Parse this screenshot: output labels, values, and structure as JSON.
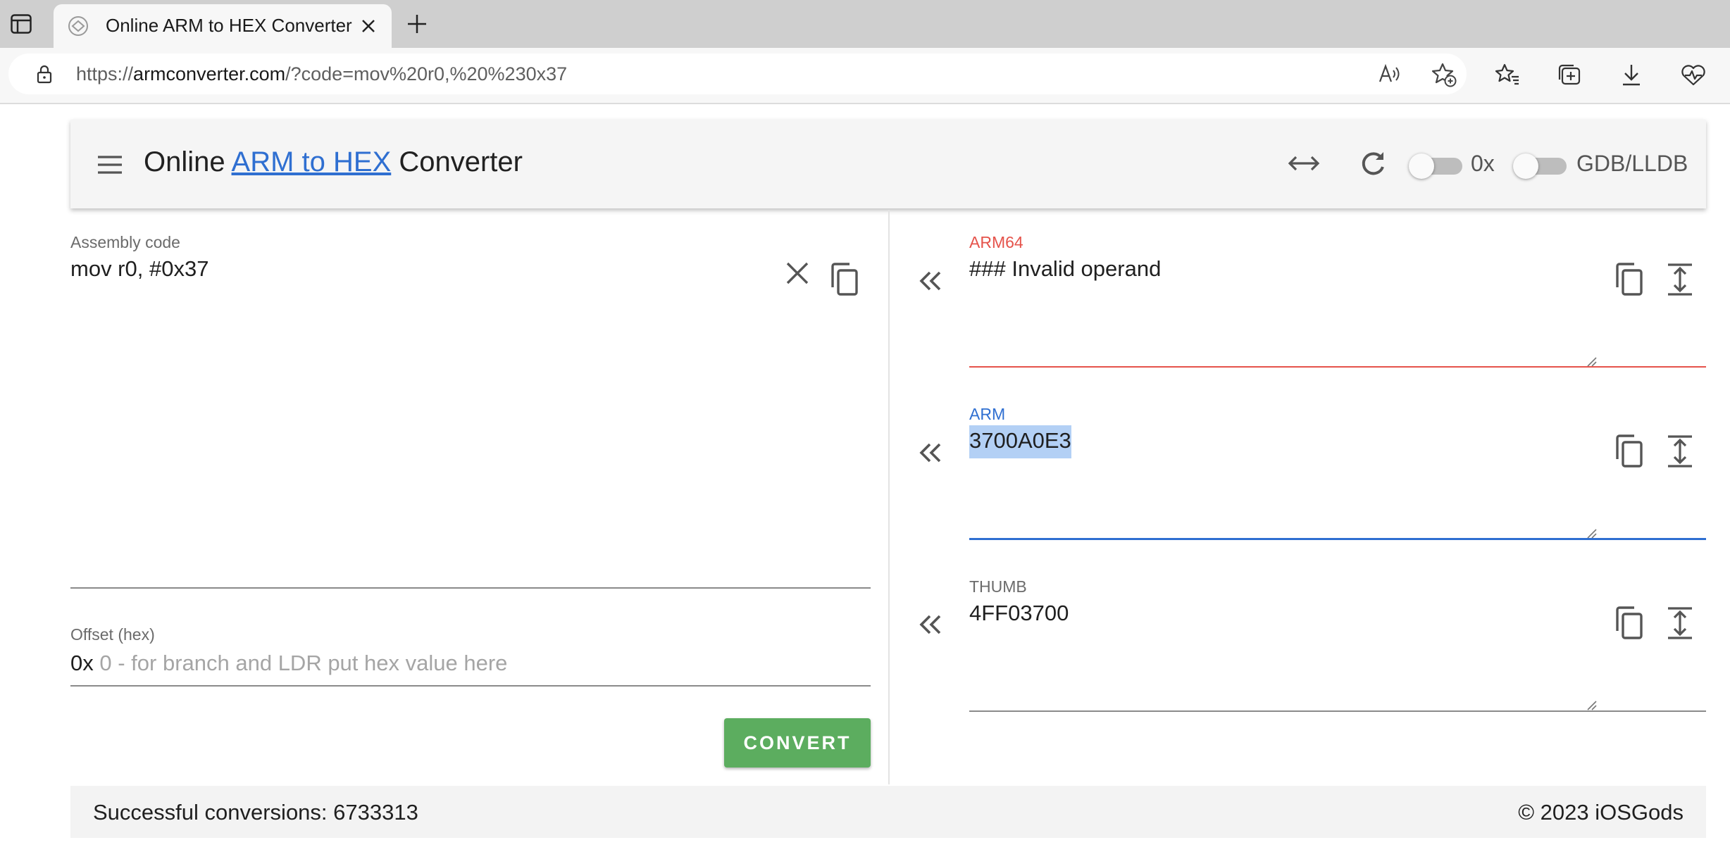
{
  "browser": {
    "tab_title": "Online ARM to HEX Converter",
    "url_prefix": "https://",
    "url_domain": "armconverter.com",
    "url_rest": "/?code=mov%20r0,%20%230x37"
  },
  "appbar": {
    "title_prefix": "Online ",
    "title_link": "ARM to HEX",
    "title_suffix": " Converter",
    "toggle_hex_label": "0x",
    "toggle_debugger_label": "GDB/LLDB"
  },
  "input": {
    "assembly_label": "Assembly code",
    "assembly_value": "mov r0, #0x37",
    "offset_label": "Offset (hex)",
    "offset_prefix": "0x",
    "offset_placeholder": "0 - for branch and LDR put hex value here",
    "convert_label": "CONVERT"
  },
  "outputs": [
    {
      "label": "ARM64",
      "value": "### Invalid operand"
    },
    {
      "label": "ARM",
      "value": "3700A0E3"
    },
    {
      "label": "THUMB",
      "value": "4FF03700"
    }
  ],
  "colors": {
    "error": "#e5534b",
    "active": "#2f6fd1",
    "convert_button": "#5cad5f"
  },
  "footer": {
    "stats": "Successful conversions: 6733313",
    "copyright": "© 2023 iOSGods"
  }
}
